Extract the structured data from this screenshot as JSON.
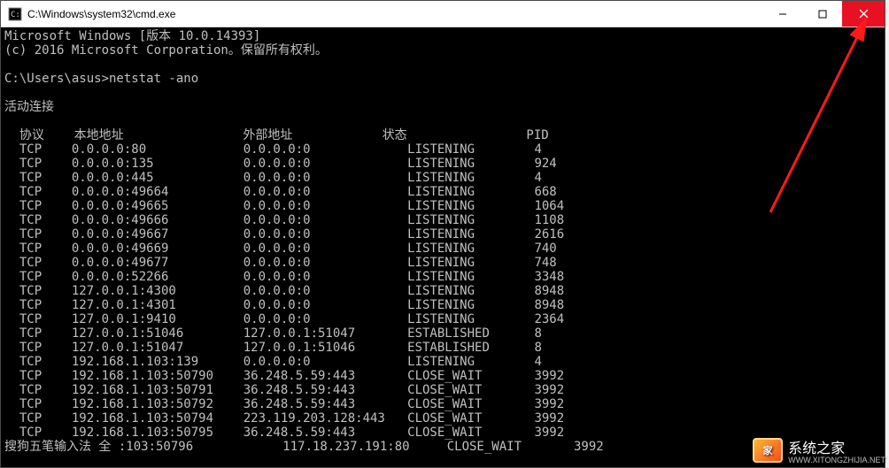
{
  "titlebar": {
    "title": "C:\\Windows\\system32\\cmd.exe"
  },
  "terminal": {
    "line_version": "Microsoft Windows [版本 10.0.14393]",
    "line_copyright": "(c) 2016 Microsoft Corporation。保留所有权利。",
    "prompt_path": "C:\\Users\\asus>",
    "command": "netstat -ano",
    "heading": "活动连接",
    "columns": {
      "proto": "协议",
      "local": "本地地址",
      "foreign": "外部地址",
      "state": "状态",
      "pid": "PID"
    },
    "rows": [
      {
        "proto": "TCP",
        "local": "0.0.0.0:80",
        "foreign": "0.0.0.0:0",
        "state": "LISTENING",
        "pid": "4"
      },
      {
        "proto": "TCP",
        "local": "0.0.0.0:135",
        "foreign": "0.0.0.0:0",
        "state": "LISTENING",
        "pid": "924"
      },
      {
        "proto": "TCP",
        "local": "0.0.0.0:445",
        "foreign": "0.0.0.0:0",
        "state": "LISTENING",
        "pid": "4"
      },
      {
        "proto": "TCP",
        "local": "0.0.0.0:49664",
        "foreign": "0.0.0.0:0",
        "state": "LISTENING",
        "pid": "668"
      },
      {
        "proto": "TCP",
        "local": "0.0.0.0:49665",
        "foreign": "0.0.0.0:0",
        "state": "LISTENING",
        "pid": "1064"
      },
      {
        "proto": "TCP",
        "local": "0.0.0.0:49666",
        "foreign": "0.0.0.0:0",
        "state": "LISTENING",
        "pid": "1108"
      },
      {
        "proto": "TCP",
        "local": "0.0.0.0:49667",
        "foreign": "0.0.0.0:0",
        "state": "LISTENING",
        "pid": "2616"
      },
      {
        "proto": "TCP",
        "local": "0.0.0.0:49669",
        "foreign": "0.0.0.0:0",
        "state": "LISTENING",
        "pid": "740"
      },
      {
        "proto": "TCP",
        "local": "0.0.0.0:49677",
        "foreign": "0.0.0.0:0",
        "state": "LISTENING",
        "pid": "748"
      },
      {
        "proto": "TCP",
        "local": "0.0.0.0:52266",
        "foreign": "0.0.0.0:0",
        "state": "LISTENING",
        "pid": "3348"
      },
      {
        "proto": "TCP",
        "local": "127.0.0.1:4300",
        "foreign": "0.0.0.0:0",
        "state": "LISTENING",
        "pid": "8948"
      },
      {
        "proto": "TCP",
        "local": "127.0.0.1:4301",
        "foreign": "0.0.0.0:0",
        "state": "LISTENING",
        "pid": "8948"
      },
      {
        "proto": "TCP",
        "local": "127.0.0.1:9410",
        "foreign": "0.0.0.0:0",
        "state": "LISTENING",
        "pid": "2364"
      },
      {
        "proto": "TCP",
        "local": "127.0.0.1:51046",
        "foreign": "127.0.0.1:51047",
        "state": "ESTABLISHED",
        "pid": "8"
      },
      {
        "proto": "TCP",
        "local": "127.0.0.1:51047",
        "foreign": "127.0.0.1:51046",
        "state": "ESTABLISHED",
        "pid": "8"
      },
      {
        "proto": "TCP",
        "local": "192.168.1.103:139",
        "foreign": "0.0.0.0:0",
        "state": "LISTENING",
        "pid": "4"
      },
      {
        "proto": "TCP",
        "local": "192.168.1.103:50790",
        "foreign": "36.248.5.59:443",
        "state": "CLOSE_WAIT",
        "pid": "3992"
      },
      {
        "proto": "TCP",
        "local": "192.168.1.103:50791",
        "foreign": "36.248.5.59:443",
        "state": "CLOSE_WAIT",
        "pid": "3992"
      },
      {
        "proto": "TCP",
        "local": "192.168.1.103:50792",
        "foreign": "36.248.5.59:443",
        "state": "CLOSE_WAIT",
        "pid": "3992"
      },
      {
        "proto": "TCP",
        "local": "192.168.1.103:50794",
        "foreign": "223.119.203.128:443",
        "state": "CLOSE_WAIT",
        "pid": "3992"
      },
      {
        "proto": "TCP",
        "local": "192.168.1.103:50795",
        "foreign": "36.248.5.59:443",
        "state": "CLOSE_WAIT",
        "pid": "3992"
      }
    ],
    "ime_line_prefix": "搜狗五笔输入法 全 :103:50796",
    "ime_line_foreign": "117.18.237.191:80",
    "ime_line_state": "CLOSE_WAIT",
    "ime_line_pid": "3992"
  },
  "watermark": {
    "text": "系统之家",
    "sub": "WWW.XITONGZHIJIA.NET"
  }
}
